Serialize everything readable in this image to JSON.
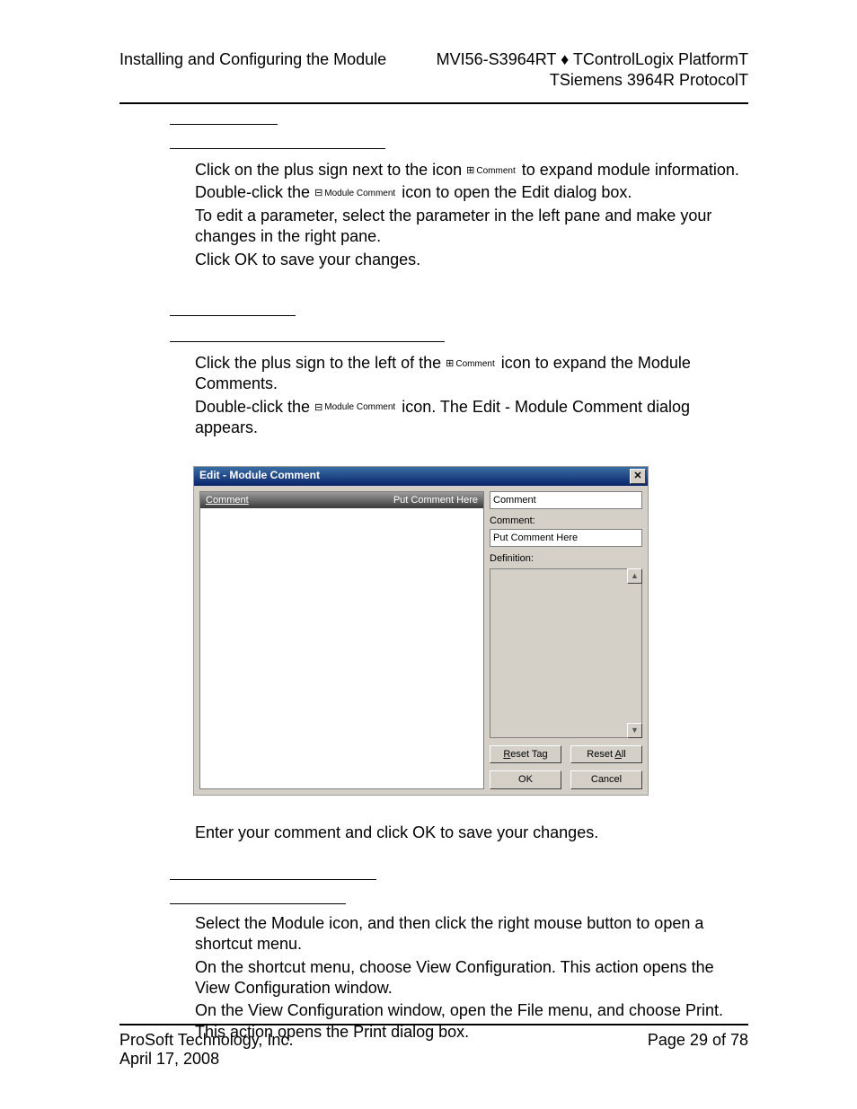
{
  "header": {
    "left": "Installing and Configuring the Module",
    "right1": "MVI56-S3964RT ♦ TControlLogix PlatformT",
    "right2": "TSiemens 3964R ProtocolT"
  },
  "icons": {
    "commentTree": "Comment",
    "moduleCommentTree": "Module Comment"
  },
  "section1": {
    "step1a": "Click on the plus sign next to the icon ",
    "step1b": " to expand module information.",
    "step2a": "Double-click the ",
    "step2b": " icon to open the Edit dialog box.",
    "step3": "To edit a parameter, select the parameter in the left pane and make your changes in the right pane.",
    "step4": "Click OK to save your changes."
  },
  "section2": {
    "step1a": "Click the plus sign to the left of the ",
    "step1b": " icon to expand the Module Comments.",
    "step2a": "Double-click the ",
    "step2b": " icon. The Edit - Module Comment dialog appears."
  },
  "dialog": {
    "title": "Edit - Module Comment",
    "leftCol1": "Comment",
    "leftCol2": "Put Comment Here",
    "rightTop": "Comment",
    "labelComment": "Comment:",
    "valueComment": "Put Comment Here",
    "labelDefinition": "Definition:",
    "buttons": {
      "resetTag": "Reset Tag",
      "resetAll": "Reset All",
      "ok": "OK",
      "cancel": "Cancel"
    }
  },
  "afterDialog": "Enter your comment and click OK to save your changes.",
  "section3": {
    "step1": "Select the Module icon, and then click the right mouse button to open a shortcut menu.",
    "step2": "On the shortcut menu, choose View Configuration. This action opens the View Configuration window.",
    "step3": "On the View Configuration window, open the File menu, and choose Print. This action opens the Print dialog box."
  },
  "footer": {
    "company": "ProSoft Technology, Inc.",
    "date": "April 17, 2008",
    "page": "Page 29 of 78"
  }
}
